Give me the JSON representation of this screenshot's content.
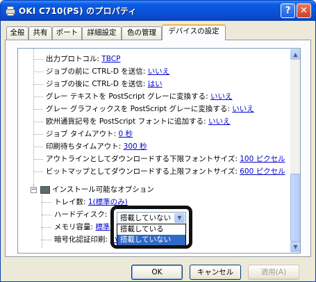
{
  "window": {
    "title": "OKI C710(PS) のプロパティ"
  },
  "titlebar": {
    "help_label": "?",
    "close_label": "✕"
  },
  "tabs": [
    {
      "label": "全般"
    },
    {
      "label": "共有"
    },
    {
      "label": "ポート"
    },
    {
      "label": "詳細設定"
    },
    {
      "label": "色の管理"
    },
    {
      "label": "デバイスの設定"
    }
  ],
  "tree": {
    "rows": [
      {
        "label": "出力プロトコル: ",
        "value": "TBCP"
      },
      {
        "label": "ジョブの前に CTRL-D を送信: ",
        "value": "いいえ"
      },
      {
        "label": "ジョブの後に CTRL-D を送信: ",
        "value": "はい"
      },
      {
        "label": "グレー テキストを PostScript グレーに変換する: ",
        "value": "いいえ"
      },
      {
        "label": "グレー グラフィックスを PostScript グレーに変換する: ",
        "value": "いいえ"
      },
      {
        "label": "欧州通貨記号を PostScript フォントに追加する: ",
        "value": "いいえ"
      },
      {
        "label": "ジョブ タイムアウト: ",
        "value": "0 秒"
      },
      {
        "label": "印刷待ちタイムアウト: ",
        "value": "300 秒"
      },
      {
        "label": "アウトラインとしてダウンロードする下限フォントサイズ: ",
        "value": "100 ピクセル"
      },
      {
        "label": "ビットマップとしてダウンロードする上限フォントサイズ: ",
        "value": "600 ピクセル"
      }
    ],
    "group_label": "インストール可能なオプション",
    "options": [
      {
        "label": "トレイ数: ",
        "value": "1(標準のみ)"
      },
      {
        "label": "ハードディスク: ",
        "value": ""
      },
      {
        "label": "メモリ容量: ",
        "value": "標準"
      },
      {
        "label": "暗号化認証印刷: ",
        "value": "いいえ"
      }
    ],
    "collapse_symbol": "−"
  },
  "combo": {
    "selected": "搭載していない",
    "options": [
      "搭載している",
      "搭載していない"
    ],
    "highlighted_index": 1
  },
  "scrollbar": {
    "up_glyph": "▲",
    "down_glyph": "▼"
  },
  "buttons": {
    "ok": "OK",
    "cancel": "キャンセル",
    "apply": "適用(A)"
  }
}
